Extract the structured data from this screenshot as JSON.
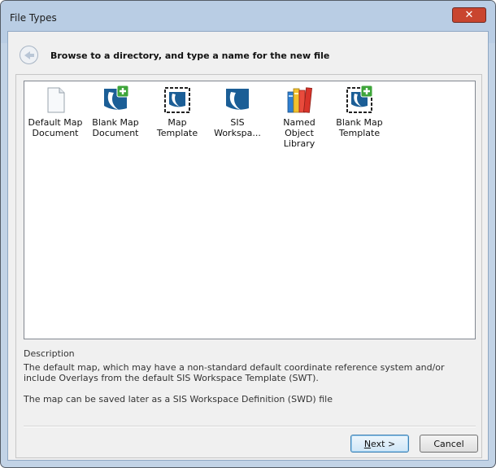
{
  "window": {
    "title": "File Types",
    "close_symbol": "✕"
  },
  "header": {
    "text": "Browse to a directory, and type a name for the new file"
  },
  "file_types": [
    {
      "label_line1": "Default Map",
      "label_line2": "Document",
      "icon": "document-icon"
    },
    {
      "label_line1": "Blank Map",
      "label_line2": "Document",
      "icon": "blank-map-document-icon"
    },
    {
      "label_line1": "Map Template",
      "label_line2": "",
      "icon": "map-template-icon"
    },
    {
      "label_line1": "SIS",
      "label_line2": "Workspa...",
      "icon": "sis-workspace-icon"
    },
    {
      "label_line1": "Named Object",
      "label_line2": "Library",
      "icon": "books-icon"
    },
    {
      "label_line1": "Blank Map",
      "label_line2": "Template",
      "icon": "blank-map-template-icon"
    }
  ],
  "description": {
    "title": "Description",
    "paragraph1": "The default map, which may have a non-standard default coordinate reference system and/or include Overlays from the default SIS Workspace Template (SWT).",
    "paragraph2": "The map can be saved later as a SIS Workspace Definition (SWD) file"
  },
  "buttons": {
    "next_mnemonic": "N",
    "next_rest": "ext >",
    "cancel": "Cancel"
  },
  "colors": {
    "sis_blue": "#1b5e96",
    "plus_green": "#3ea53a",
    "close_red": "#c9452f"
  }
}
